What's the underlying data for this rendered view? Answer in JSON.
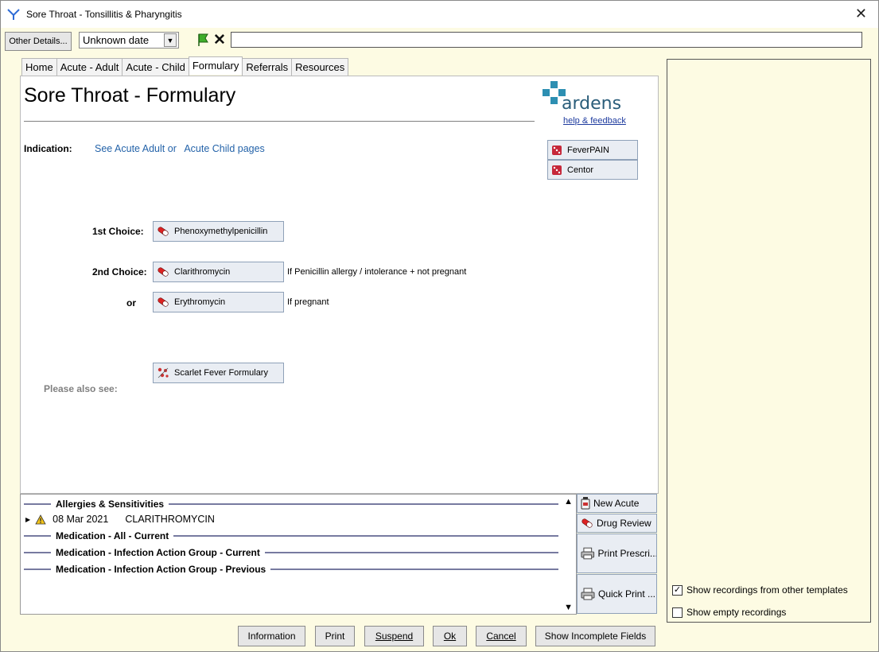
{
  "window": {
    "title": "Sore Throat - Tonsillitis & Pharyngitis",
    "close_glyph": "✕"
  },
  "toolbar": {
    "other_details_label": "Other Details...",
    "date_value": "Unknown date",
    "free_text_value": ""
  },
  "tabs": [
    {
      "label": "Home"
    },
    {
      "label": "Acute - Adult"
    },
    {
      "label": "Acute - Child"
    },
    {
      "label": "Formulary"
    },
    {
      "label": "Referrals"
    },
    {
      "label": "Resources"
    }
  ],
  "active_tab": "Formulary",
  "page": {
    "title": "Sore Throat - Formulary",
    "logo_text": "ardens",
    "logo_link": "help & feedback",
    "indication_label": "Indication:",
    "indication_link_1": "See Acute Adult or",
    "indication_link_2": "Acute Child pages",
    "score_buttons": [
      "FeverPAIN",
      "Centor"
    ],
    "first_choice_label": "1st Choice:",
    "first_choice_drug": "Phenoxymethylpenicillin",
    "second_choice_label": "2nd Choice:",
    "second_choice_drug": "Clarithromycin",
    "second_choice_note": "If Penicillin allergy / intolerance + not pregnant",
    "or_label": "or",
    "alt_choice_drug": "Erythromycin",
    "alt_choice_note": "If pregnant",
    "see_also_label": "Please also see:",
    "see_also_button": "Scarlet Fever Formulary"
  },
  "records": {
    "sections": [
      "Allergies & Sensitivities",
      "Medication - All - Current",
      "Medication - Infection Action Group - Current",
      "Medication - Infection Action Group - Previous"
    ],
    "allergy_entry": {
      "date": "08 Mar 2021",
      "name": "CLARITHROMYCIN"
    }
  },
  "side_buttons": [
    "New Acute",
    "Drug Review",
    "Print Prescri...",
    "Quick Print ..."
  ],
  "bottom_buttons": [
    {
      "label": "Information"
    },
    {
      "label": "Print"
    },
    {
      "label": "Suspend"
    },
    {
      "label": "Ok"
    },
    {
      "label": "Cancel"
    },
    {
      "label": "Show Incomplete Fields"
    }
  ],
  "right_panel": {
    "show_other_templates": {
      "label": "Show recordings from other templates",
      "checked": true
    },
    "show_empty": {
      "label": "Show empty recordings",
      "checked": false
    }
  },
  "colors": {
    "link_blue": "#2463a9",
    "panel_bg": "#fdfbe3",
    "button_bg": "#e9edf3",
    "logo_teal": "#2a5d7a"
  }
}
